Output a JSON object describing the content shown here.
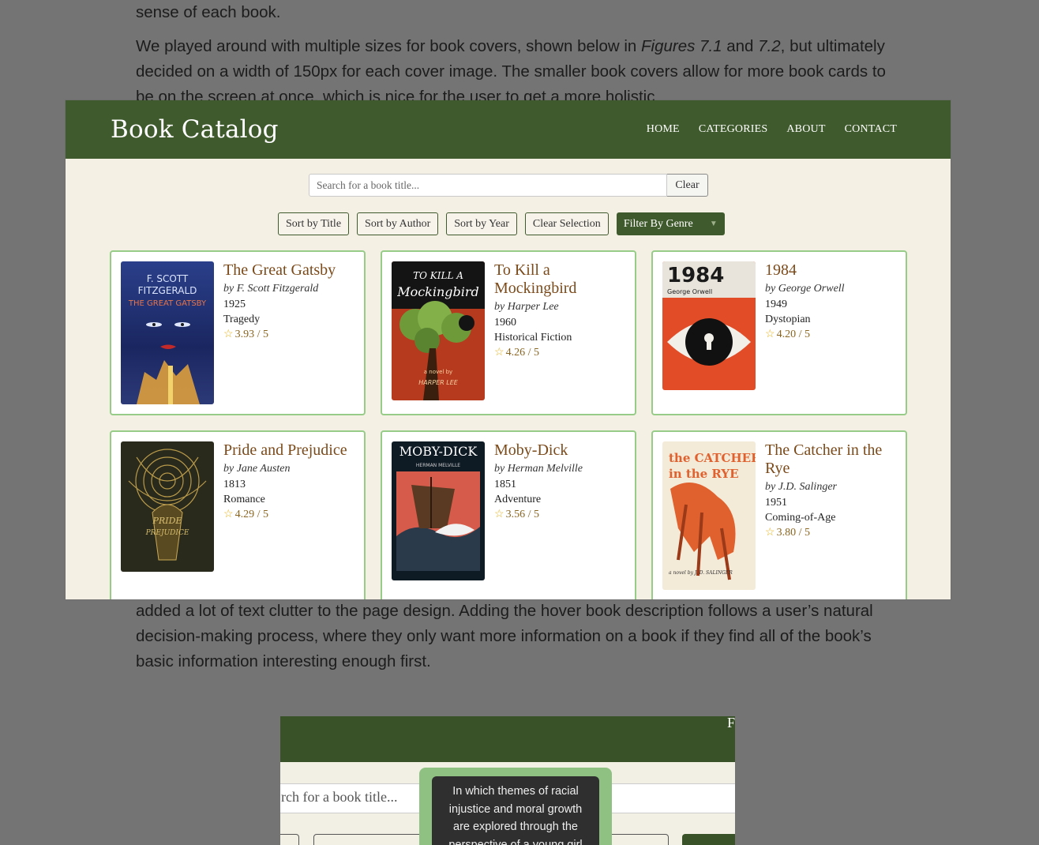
{
  "document": {
    "top_line_1": "sense of each book.",
    "top_para_a": "We played around with multiple sizes for book covers, shown below in ",
    "fig_1": "Figures 7.1",
    "and": " and ",
    "fig_2": "7.2",
    "top_para_b": ", but ultimately decided on a width of 150px for each cover image. The smaller book covers allow for more book cards to be on the screen at once, which is nice for the user to get a more holistic",
    "bottom_para": "added a lot of text clutter to the page design. Adding the hover book description follows a user’s natural decision-making process, where they only want more information on a book if they find all of the book’s basic information interesting enough first."
  },
  "app": {
    "brand": "Book Catalog",
    "nav": [
      "HOME",
      "CATEGORIES",
      "ABOUT",
      "CONTACT"
    ],
    "search_placeholder": "Search for a book title...",
    "clear_label": "Clear",
    "sort_buttons": [
      "Sort by Title",
      "Sort by Author",
      "Sort by Year",
      "Clear Selection"
    ],
    "genre_filter": "Filter By Genre",
    "books": [
      {
        "title": "The Great Gatsby",
        "author": "by F. Scott Fitzgerald",
        "year": "1925",
        "genre": "Tragedy",
        "rating": "3.93 / 5",
        "cover_text": [
          "F. SCOTT",
          "FITZGERALD",
          "THE GREAT GATSBY"
        ]
      },
      {
        "title": "To Kill a Mockingbird",
        "author": "by Harper Lee",
        "year": "1960",
        "genre": "Historical Fiction",
        "rating": "4.26 / 5",
        "cover_text": [
          "TO KILL A",
          "Mockingbird",
          "a novel by",
          "HARPER LEE"
        ]
      },
      {
        "title": "1984",
        "author": "by George Orwell",
        "year": "1949",
        "genre": "Dystopian",
        "rating": "4.20 / 5",
        "cover_text": [
          "1984",
          "George Orwell"
        ]
      },
      {
        "title": "Pride and Prejudice",
        "author": "by Jane Austen",
        "year": "1813",
        "genre": "Romance",
        "rating": "4.29 / 5",
        "cover_text": [
          "PRIDE",
          "PREJUDICE"
        ]
      },
      {
        "title": "Moby-Dick",
        "author": "by Herman Melville",
        "year": "1851",
        "genre": "Adventure",
        "rating": "3.56 / 5",
        "cover_text": [
          "MOBY-DICK",
          "HERMAN MELVILLE"
        ]
      },
      {
        "title": "The Catcher in the Rye",
        "author": "by J.D. Salinger",
        "year": "1951",
        "genre": "Coming-of-Age",
        "rating": "3.80 / 5",
        "cover_text": [
          "the CATCHER",
          "in the RYE",
          "a novel by J. D. SALINGER"
        ]
      }
    ]
  },
  "second_shot": {
    "search_placeholder_partial": "rch for a book title...",
    "tooltip": "In which themes of racial injustice and moral growth are explored through the perspective of a young girl"
  },
  "colors": {
    "header_green": "#3f5a2c",
    "card_border": "#96cc88",
    "title_brown": "#7b4a1a",
    "page_bg": "#747474"
  }
}
